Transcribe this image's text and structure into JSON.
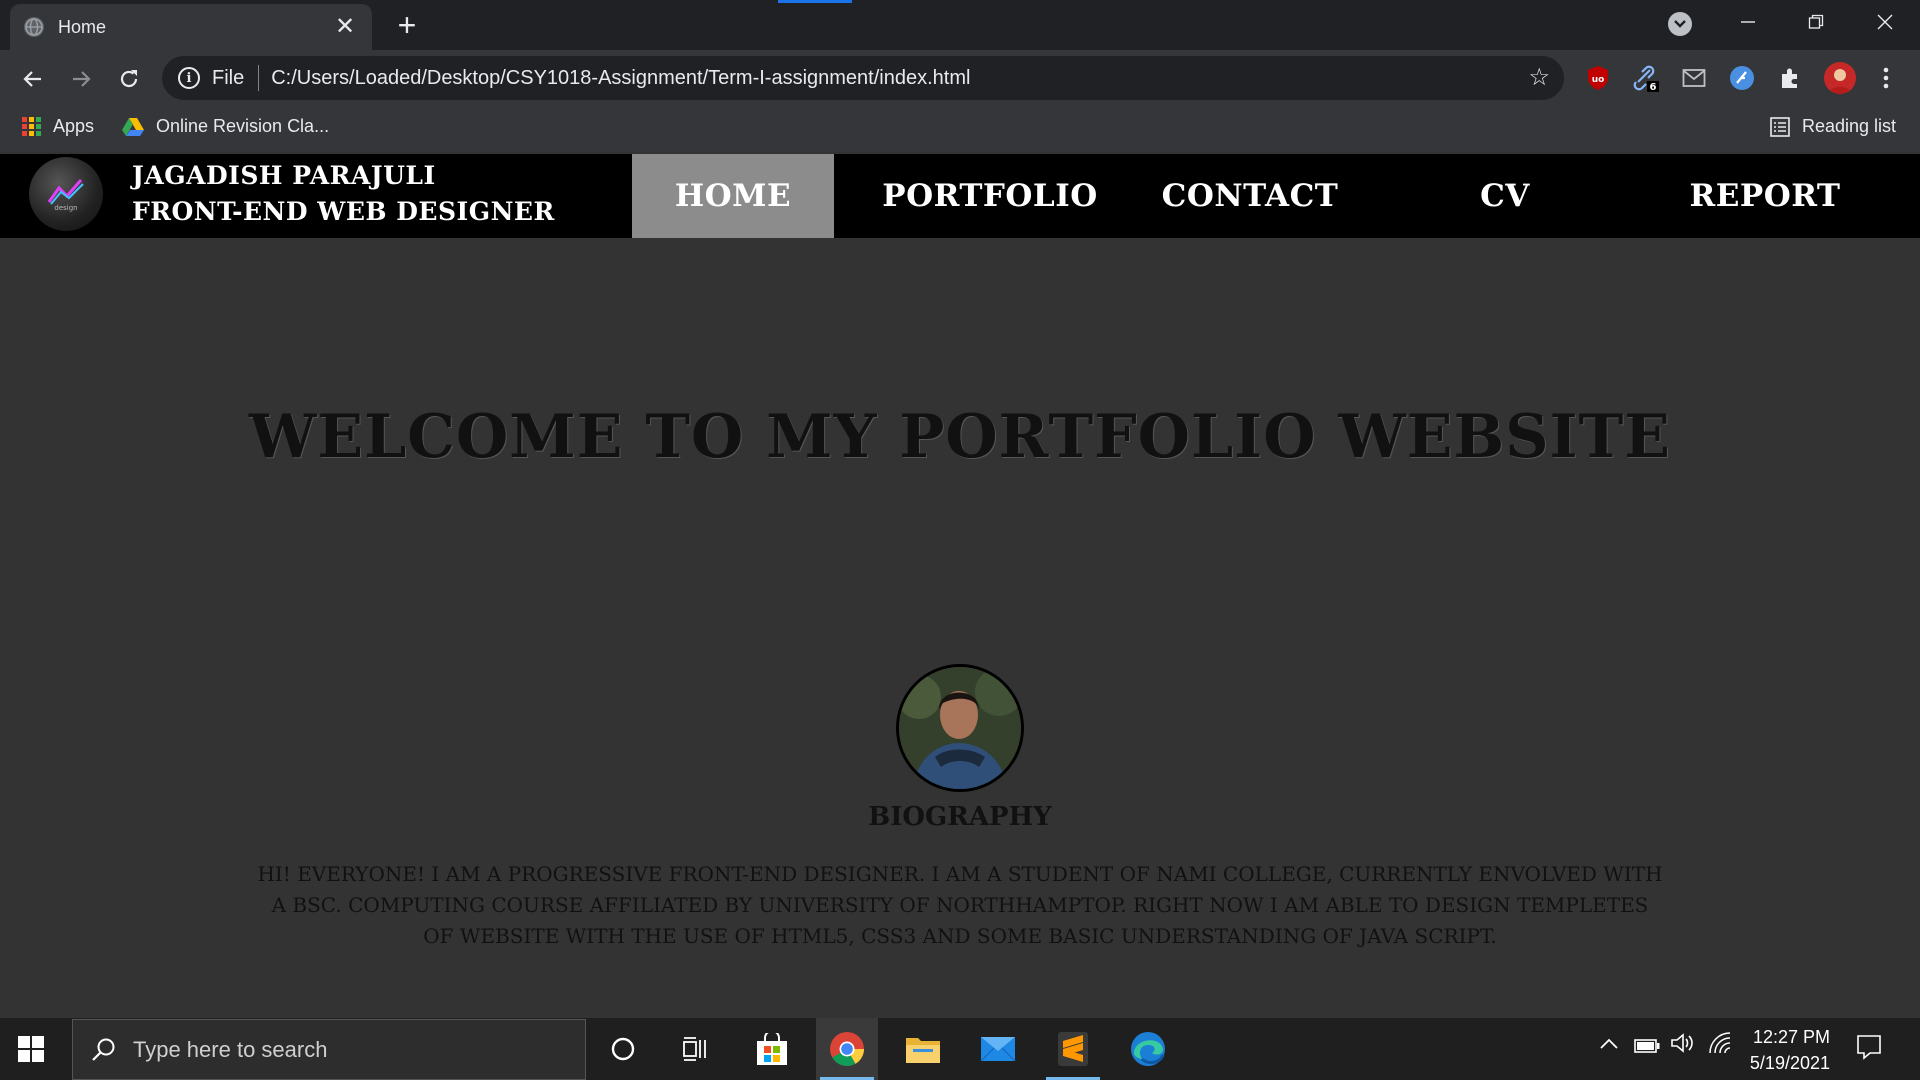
{
  "browser": {
    "tab_title": "Home",
    "tab_close": "✕",
    "new_tab": "+",
    "address_scheme": "File",
    "address_url": "C:/Users/Loaded/Desktop/CSY1018-Assignment/Term-I-assignment/index.html",
    "extension_badge": "6",
    "bookmarks": [
      {
        "label": "Apps"
      },
      {
        "label": "Online Revision Cla..."
      }
    ],
    "reading_list": "Reading list"
  },
  "site": {
    "brand_line1": "JAGADISH PARAJULI",
    "brand_line2": "FRONT-END WEB DESIGNER",
    "nav": [
      {
        "label": "HOME",
        "active": true
      },
      {
        "label": "PORTFOLIO",
        "active": false
      },
      {
        "label": "CONTACT",
        "active": false
      },
      {
        "label": "CV",
        "active": false
      },
      {
        "label": "REPORT",
        "active": false
      }
    ],
    "welcome": "WELCOME TO MY PORTFOLIO WEBSITE",
    "bio_heading": "BIOGRAPHY",
    "bio_text": "Hi! Everyone! I am a progressive Front-end designer. I am a student of NAMI College, currently envolved with a BSc. Computing course affiliated by University of Northhamptop. Right now I am able to design templetes of website with the use of HTML5, CSS3 and some basic understanding of Java Script."
  },
  "taskbar": {
    "search_placeholder": "Type here to search",
    "time": "12:27 PM",
    "date": "5/19/2021"
  },
  "colors": {
    "chrome_dark": "#202124",
    "chrome_toolbar": "#35363a",
    "page_bg": "#333333",
    "header_bg": "#000000",
    "nav_active": "#8c8c8c",
    "taskbar": "#1f1f1f"
  }
}
